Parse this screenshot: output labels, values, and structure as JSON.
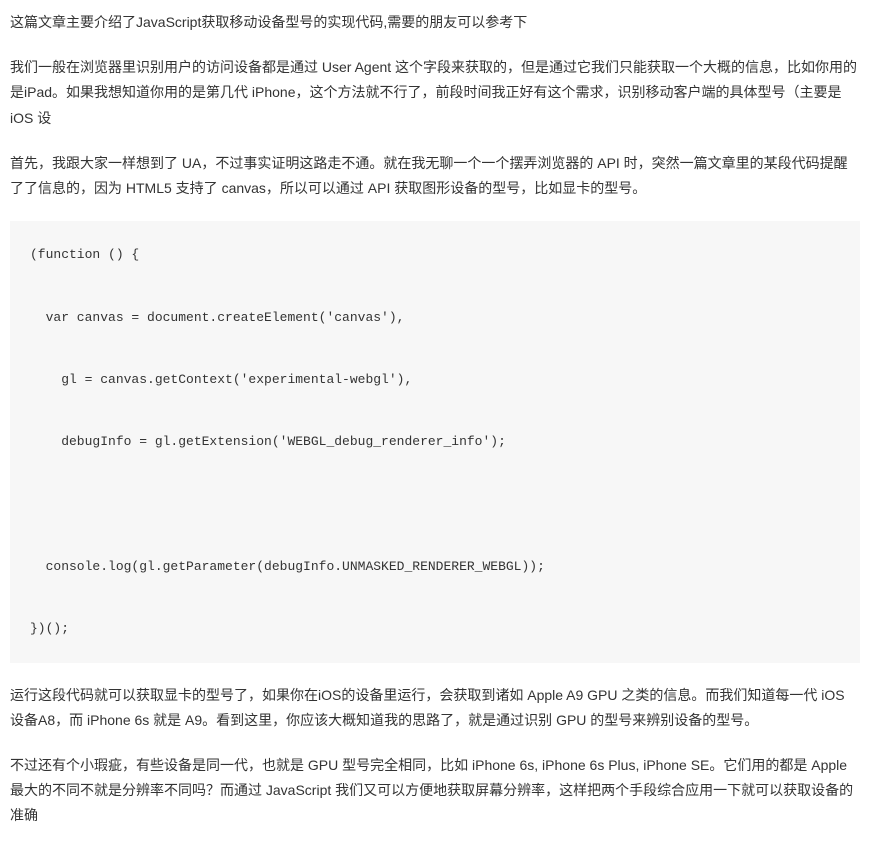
{
  "intro": "这篇文章主要介绍了JavaScript获取移动设备型号的实现代码,需要的朋友可以参考下",
  "para1": "我们一般在浏览器里识别用户的访问设备都是通过 User Agent 这个字段来获取的，但是通过它我们只能获取一个大概的信息，比如你用的是iPad。如果我想知道你用的是第几代 iPhone，这个方法就不行了，前段时间我正好有这个需求，识别移动客户端的具体型号（主要是 iOS 设",
  "para2": "首先，我跟大家一样想到了 UA，不过事实证明这路走不通。就在我无聊一个一个摆弄浏览器的 API 时，突然一篇文章里的某段代码提醒了了信息的，因为 HTML5 支持了 canvas，所以可以通过 API 获取图形设备的型号，比如显卡的型号。",
  "code": "(function () {\n\n  var canvas = document.createElement('canvas'),\n\n    gl = canvas.getContext('experimental-webgl'),\n\n    debugInfo = gl.getExtension('WEBGL_debug_renderer_info');\n\n\n\n  console.log(gl.getParameter(debugInfo.UNMASKED_RENDERER_WEBGL));\n\n})();",
  "para3": "运行这段代码就可以获取显卡的型号了，如果你在iOS的设备里运行，会获取到诸如 Apple A9 GPU 之类的信息。而我们知道每一代 iOS 设备A8，而 iPhone 6s 就是 A9。看到这里，你应该大概知道我的思路了，就是通过识别 GPU 的型号来辨别设备的型号。",
  "para4": "不过还有个小瑕疵，有些设备是同一代，也就是 GPU 型号完全相同，比如 iPhone 6s, iPhone 6s Plus, iPhone SE。它们用的都是 Apple 最大的不同不就是分辨率不同吗？而通过 JavaScript 我们又可以方便地获取屏幕分辨率，这样把两个手段综合应用一下就可以获取设备的准确"
}
